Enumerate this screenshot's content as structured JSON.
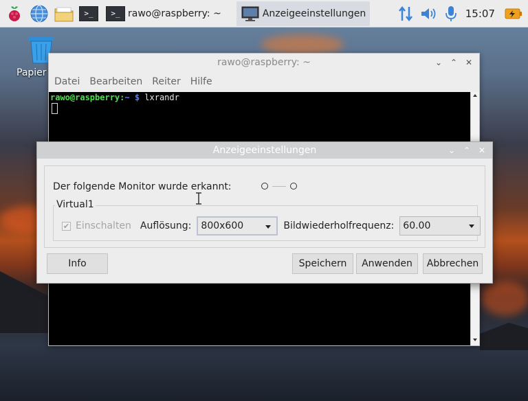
{
  "taskbar": {
    "terminal_task_label": "rawo@raspberry: ~",
    "display_task_label": "Anzeigeeinstellungen",
    "clock": "15:07",
    "terminal_glyph": ">_"
  },
  "desktop": {
    "trash_label": "Papier"
  },
  "terminal": {
    "title": "rawo@raspberry: ~",
    "menu": [
      "Datei",
      "Bearbeiten",
      "Reiter",
      "Hilfe"
    ],
    "prompt_user": "rawo@raspberry:",
    "prompt_path": "~ $",
    "command": " lxrandr"
  },
  "dialog": {
    "title": "Anzeigeeinstellungen",
    "detected_label": "Der folgende Monitor wurde erkannt:",
    "group_label": "Virtual1",
    "enable_label": "Einschalten",
    "resolution_label": "Auflösung:",
    "resolution_value": "800x600",
    "refresh_label": "Bildwiederholfrequenz:",
    "refresh_value": "60.00",
    "buttons": {
      "info": "Info",
      "save": "Speichern",
      "apply": "Anwenden",
      "cancel": "Abbrechen"
    }
  },
  "window_controls": {
    "minimize": "⌄",
    "maximize": "⌃",
    "close": "✕"
  },
  "colors": {
    "prompt_user": "#4ee04e",
    "prompt_path": "#5a7cff",
    "taskbar_bg": "#ececec"
  }
}
